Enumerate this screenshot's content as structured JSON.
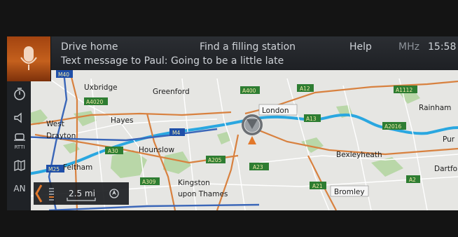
{
  "voice": {
    "commands": [
      "Drive home",
      "Find a filling station",
      "Help"
    ],
    "message": "Text message to Paul: Going to be a little late"
  },
  "status": {
    "band": "MHz",
    "time": "15:58"
  },
  "sidebar": {
    "icons": [
      "timer-icon",
      "speaker-icon",
      "rtti-icon",
      "map-book-icon",
      "compass-icon"
    ],
    "rtti_label": "RTTI",
    "bottom_label": "AN"
  },
  "map": {
    "places": [
      "Uxbridge",
      "Greenford",
      "London",
      "Rainham",
      "West",
      "Drayton",
      "Hayes",
      "Hounslow",
      "Bexleyheath",
      "Pur",
      "Dartfo",
      "Feltham",
      "Kingston",
      "upon Thames",
      "Bromley"
    ],
    "roads": [
      "M40",
      "A4020",
      "A400",
      "A12",
      "A1112",
      "M4",
      "A13",
      "A2016",
      "A30",
      "A205",
      "A23",
      "A309",
      "A21",
      "A2",
      "M25"
    ]
  },
  "scale": {
    "value": "2.5 mi"
  },
  "colors": {
    "accent": "#c4601d",
    "road_sign": "#2e7d32",
    "motorway_sign": "#1f4fa8",
    "river": "#2aa7e0"
  }
}
